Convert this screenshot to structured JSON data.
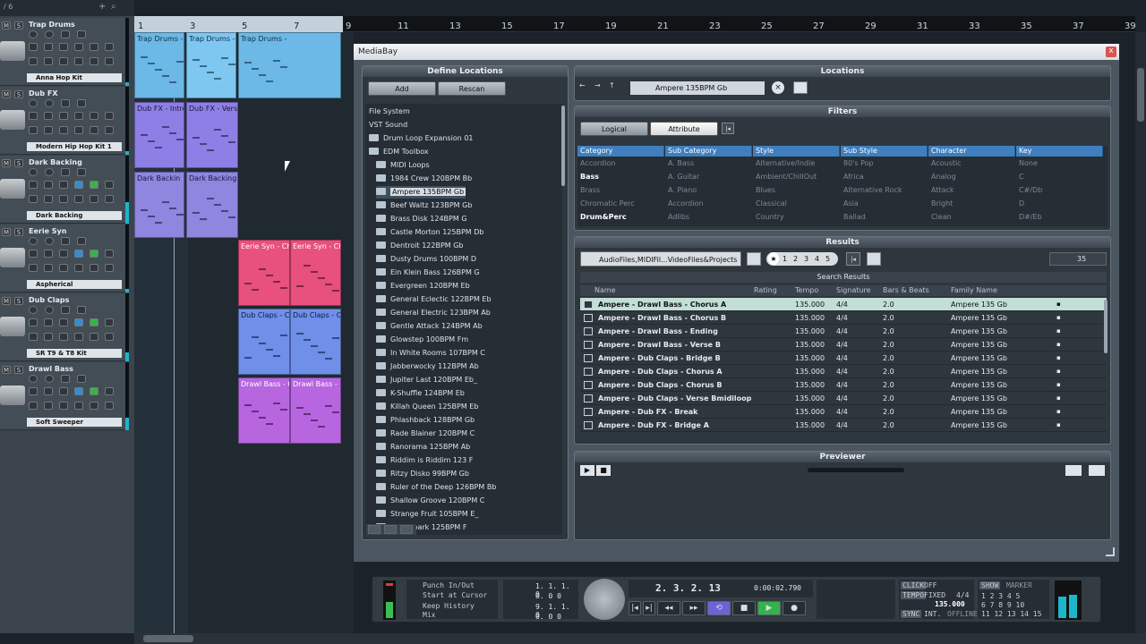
{
  "tracklist": {
    "counter": "/ 6",
    "plus": "+",
    "search": "⌕",
    "tracks": [
      {
        "name": "Trap Drums",
        "preset": "Anna Hop Kit"
      },
      {
        "name": "Dub FX",
        "preset": "Modern Hip Hop Kit 1"
      },
      {
        "name": "Dark Backing",
        "preset": "Dark Backing"
      },
      {
        "name": "Eerie Syn",
        "preset": "Aspherical"
      },
      {
        "name": "Dub Claps",
        "preset": "SR T9 & T8 Kit"
      },
      {
        "name": "Drawl Bass",
        "preset": "Soft Sweeper"
      }
    ]
  },
  "ruler": [
    "1",
    "3",
    "5",
    "7",
    "9",
    "11",
    "13",
    "15",
    "17",
    "19",
    "21",
    "23",
    "25",
    "27",
    "29",
    "31",
    "33",
    "35",
    "37",
    "39"
  ],
  "clips": [
    {
      "label": "Trap Drums -"
    },
    {
      "label": "Trap Drums -"
    },
    {
      "label": "Trap Drums -"
    },
    {
      "label": "Dub FX - Intro"
    },
    {
      "label": "Dub FX - Vers"
    },
    {
      "label": "Dark Backin"
    },
    {
      "label": "Dark Backing"
    },
    {
      "label": "Eerie Syn - Ch"
    },
    {
      "label": "Eerie Syn - Ch"
    },
    {
      "label": "Dub Claps - C"
    },
    {
      "label": "Dub Claps - C"
    },
    {
      "label": "Drawl Bass - C"
    },
    {
      "label": "Drawl Bass - C"
    }
  ],
  "mediabay": {
    "title": "MediaBay",
    "close": "x",
    "define_locations": {
      "title": "Define Locations",
      "add": "Add",
      "rescan": "Rescan",
      "tree": [
        {
          "label": "File System",
          "level": 0
        },
        {
          "label": "VST Sound",
          "level": 0
        },
        {
          "label": "Drum Loop Expansion 01",
          "level": 1
        },
        {
          "label": "EDM Toolbox",
          "level": 1
        },
        {
          "label": "MIDI Loops",
          "level": 2
        },
        {
          "label": "1984 Crew 120BPM Bb",
          "level": 3
        },
        {
          "label": "Ampere 135BPM Gb",
          "level": 3
        },
        {
          "label": "Beef Waltz 123BPM Gb",
          "level": 3
        },
        {
          "label": "Brass Disk 124BPM G",
          "level": 3
        },
        {
          "label": "Castle Morton 125BPM Db",
          "level": 3
        },
        {
          "label": "Dentroit 122BPM Gb",
          "level": 3
        },
        {
          "label": "Dusty Drums 100BPM D",
          "level": 3
        },
        {
          "label": "Ein Klein Bass 126BPM G",
          "level": 3
        },
        {
          "label": "Evergreen 120BPM Eb",
          "level": 3
        },
        {
          "label": "General Eclectic 122BPM Eb",
          "level": 3
        },
        {
          "label": "General Electric 123BPM Ab",
          "level": 3
        },
        {
          "label": "Gentle Attack 124BPM Ab",
          "level": 3
        },
        {
          "label": "Glowstep 100BPM Fm",
          "level": 3
        },
        {
          "label": "In White Rooms 107BPM C",
          "level": 3
        },
        {
          "label": "Jabberwocky 112BPM Ab",
          "level": 3
        },
        {
          "label": "Jupiter Last 120BPM Eb_",
          "level": 3
        },
        {
          "label": "K-Shuffle 124BPM Eb",
          "level": 3
        },
        {
          "label": "Killah Queen 125BPM Eb",
          "level": 3
        },
        {
          "label": "Phlashback 128BPM Gb",
          "level": 3
        },
        {
          "label": "Rade Blainer 120BPM C",
          "level": 3
        },
        {
          "label": "Ranorama 125BPM Ab",
          "level": 3
        },
        {
          "label": "Riddim is Riddim 123 F",
          "level": 3
        },
        {
          "label": "Ritzy Disko 99BPM Gb",
          "level": 3
        },
        {
          "label": "Ruler of the Deep 126BPM Bb",
          "level": 3
        },
        {
          "label": "Shallow Groove 120BPM C",
          "level": 3
        },
        {
          "label": "Strange Fruit 105BPM E_",
          "level": 3
        },
        {
          "label": "Vital Spark 125BPM F",
          "level": 3
        }
      ]
    },
    "locations": {
      "title": "Locations",
      "current": "Ampere 135BPM Gb"
    },
    "filters": {
      "title": "Filters",
      "logical": "Logical",
      "attribute": "Attribute",
      "columns": [
        {
          "header": "Category",
          "values": [
            "Accordion",
            "Bass",
            "Brass",
            "Chromatic Perc",
            "Drum&Perc"
          ]
        },
        {
          "header": "Sub Category",
          "values": [
            "A. Bass",
            "A. Guitar",
            "A. Piano",
            "Accordion",
            "Adlibs"
          ]
        },
        {
          "header": "Style",
          "values": [
            "Alternative/Indie",
            "Ambient/ChillOut",
            "Blues",
            "Classical",
            "Country"
          ]
        },
        {
          "header": "Sub Style",
          "values": [
            "80's Pop",
            "Africa",
            "Alternative Rock",
            "Asia",
            "Ballad"
          ]
        },
        {
          "header": "Character",
          "values": [
            "Acoustic",
            "Analog",
            "Attack",
            "Bright",
            "Clean"
          ]
        },
        {
          "header": "Key",
          "values": [
            "None",
            "C",
            "C#/Db",
            "D",
            "D#/Eb"
          ]
        }
      ]
    },
    "results": {
      "title": "Results",
      "scope": "AudioFiles,MIDIFil...VideoFiles&Projects",
      "star": "★",
      "ratings": [
        "1",
        "2",
        "3",
        "4",
        "5"
      ],
      "count": "35",
      "search": "Search Results",
      "headers": {
        "name": "Name",
        "rating": "Rating",
        "tempo": "Tempo",
        "signature": "Signature",
        "bars": "Bars & Beats",
        "key": "Family Name"
      },
      "rows": [
        {
          "name": "Ampere - Drawl Bass - Chorus A",
          "tempo": "135.000",
          "sig": "4/4",
          "bars": "2.0",
          "family": "Ampere 135 Gb"
        },
        {
          "name": "Ampere - Drawl Bass - Chorus B",
          "tempo": "135.000",
          "sig": "4/4",
          "bars": "2.0",
          "family": "Ampere 135 Gb"
        },
        {
          "name": "Ampere - Drawl Bass - Ending",
          "tempo": "135.000",
          "sig": "4/4",
          "bars": "2.0",
          "family": "Ampere 135 Gb"
        },
        {
          "name": "Ampere - Drawl Bass - Verse B",
          "tempo": "135.000",
          "sig": "4/4",
          "bars": "2.0",
          "family": "Ampere 135 Gb"
        },
        {
          "name": "Ampere - Dub Claps - Bridge B",
          "tempo": "135.000",
          "sig": "4/4",
          "bars": "2.0",
          "family": "Ampere 135 Gb"
        },
        {
          "name": "Ampere - Dub Claps - Chorus A",
          "tempo": "135.000",
          "sig": "4/4",
          "bars": "2.0",
          "family": "Ampere 135 Gb"
        },
        {
          "name": "Ampere - Dub Claps - Chorus B",
          "tempo": "135.000",
          "sig": "4/4",
          "bars": "2.0",
          "family": "Ampere 135 Gb"
        },
        {
          "name": "Ampere - Dub Claps - Verse Bmidiloop",
          "tempo": "135.000",
          "sig": "4/4",
          "bars": "2.0",
          "family": "Ampere 135 Gb"
        },
        {
          "name": "Ampere - Dub FX - Break",
          "tempo": "135.000",
          "sig": "4/4",
          "bars": "2.0",
          "family": "Ampere 135 Gb"
        },
        {
          "name": "Ampere - Dub FX - Bridge A",
          "tempo": "135.000",
          "sig": "4/4",
          "bars": "2.0",
          "family": "Ampere 135 Gb"
        }
      ]
    },
    "previewer": {
      "title": "Previewer"
    }
  },
  "transport": {
    "punch": "Punch In/Out",
    "start": "Start at Cursor",
    "keep": "Keep History",
    "mix": "Mix",
    "l_pos": "1. 1. 1.   0",
    "l_sub": "0.  0   0",
    "r_pos": "9. 1. 1.   0",
    "r_sub": "0.  0   0",
    "position": "2. 3. 2. 13",
    "time": "0:00:02.790",
    "click": "CLICK",
    "click_val": "OFF",
    "tempo": "TEMPO",
    "tempo_mode": "FIXED",
    "signature": "4/4",
    "tempo_val": "135.000",
    "sync": "SYNC",
    "sync_val": "INT.",
    "offline": "OFFLINE",
    "show": "SHOW",
    "marker": "MARKER",
    "marker_rows": [
      "1  2  3  4  5",
      "6  7  8  9  10",
      "11 12 13 14 15"
    ]
  }
}
